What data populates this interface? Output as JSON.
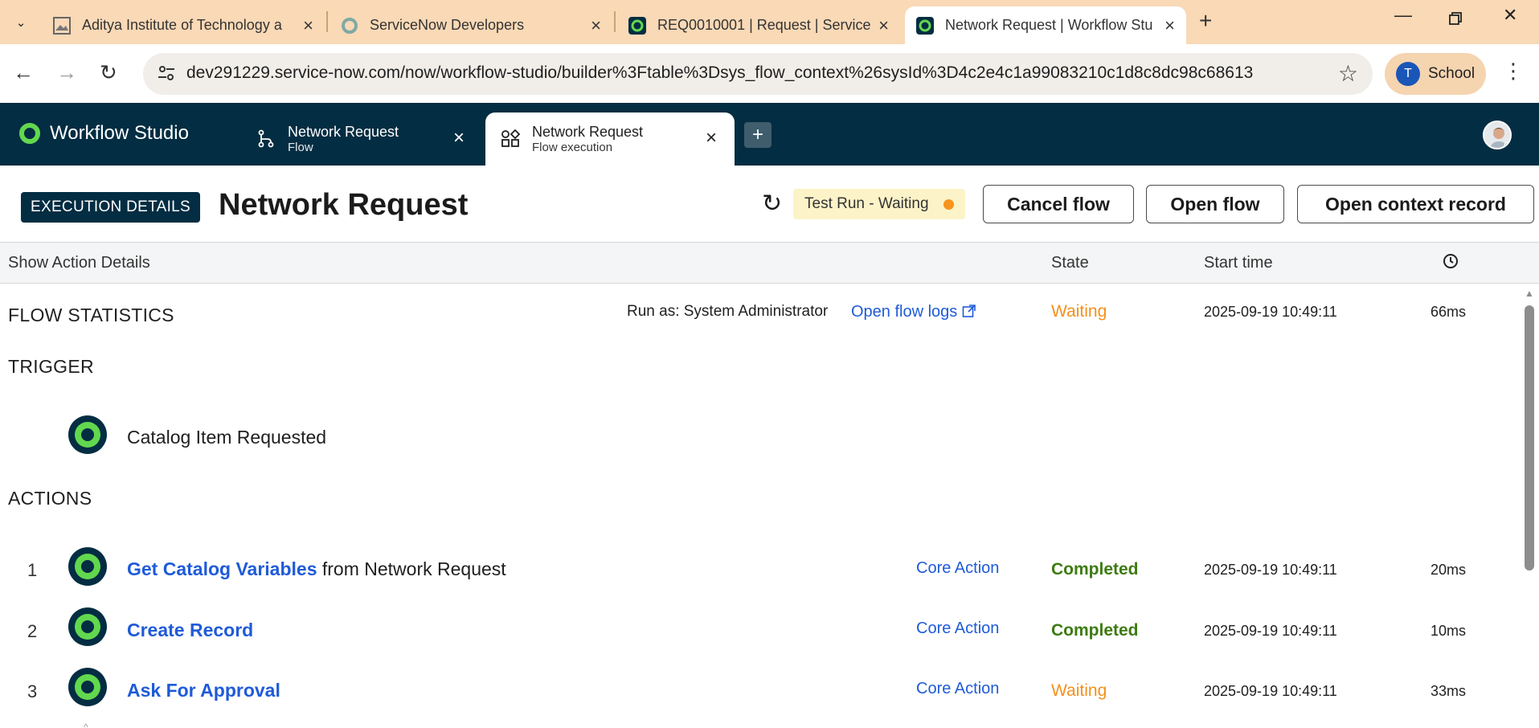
{
  "browser": {
    "tabs": [
      {
        "title": "Aditya Institute of Technology a",
        "icon": "image-icon"
      },
      {
        "title": "ServiceNow Developers",
        "icon": "servicenow-icon"
      },
      {
        "title": "REQ0010001 | Request | ServiceN",
        "icon": "servicenow-green-icon"
      },
      {
        "title": "Network Request | Workflow Stu",
        "icon": "servicenow-green-icon"
      }
    ],
    "url": "dev291229.service-now.com/now/workflow-studio/builder%3Ftable%3Dsys_flow_context%26sysId%3D4c2e4c1a99083210c1d8c8dc98c68613",
    "profile_initial": "T",
    "profile_label": "School"
  },
  "studio": {
    "app_name": "Workflow Studio",
    "tabs": [
      {
        "title": "Network Request",
        "subtitle": "Flow"
      },
      {
        "title": "Network Request",
        "subtitle": "Flow execution"
      }
    ]
  },
  "execution": {
    "badge": "EXECUTION DETAILS",
    "title": "Network Request",
    "status": "Test Run - Waiting",
    "buttons": {
      "cancel": "Cancel flow",
      "open_flow": "Open flow",
      "open_context": "Open context record"
    }
  },
  "columns": {
    "details": "Show Action Details",
    "state": "State",
    "start": "Start time"
  },
  "flow_stats": {
    "heading": "FLOW STATISTICS",
    "run_as": "Run as: System Administrator",
    "logs_link": "Open flow logs",
    "state": "Waiting",
    "start": "2025-09-19 10:49:11",
    "duration": "66ms"
  },
  "trigger": {
    "heading": "TRIGGER",
    "label": "Catalog Item Requested"
  },
  "actions": {
    "heading": "ACTIONS",
    "rows": [
      {
        "num": "1",
        "name": "Get Catalog Variables",
        "suffix": " from Network Request",
        "type": "Core Action",
        "state": "Completed",
        "start": "2025-09-19 10:49:11",
        "duration": "20ms"
      },
      {
        "num": "2",
        "name": "Create Record",
        "suffix": "",
        "type": "Core Action",
        "state": "Completed",
        "start": "2025-09-19 10:49:11",
        "duration": "10ms"
      },
      {
        "num": "3",
        "name": "Ask For Approval",
        "suffix": "",
        "type": "Core Action",
        "state": "Waiting",
        "start": "2025-09-19 10:49:11",
        "duration": "33ms"
      }
    ]
  },
  "colors": {
    "tabstrip": "#f9d9b6",
    "header": "#032d42",
    "accent_green": "#62d84e",
    "link_blue": "#1f5bd8",
    "waiting_orange": "#f3901b",
    "completed_green": "#3d7b12"
  }
}
